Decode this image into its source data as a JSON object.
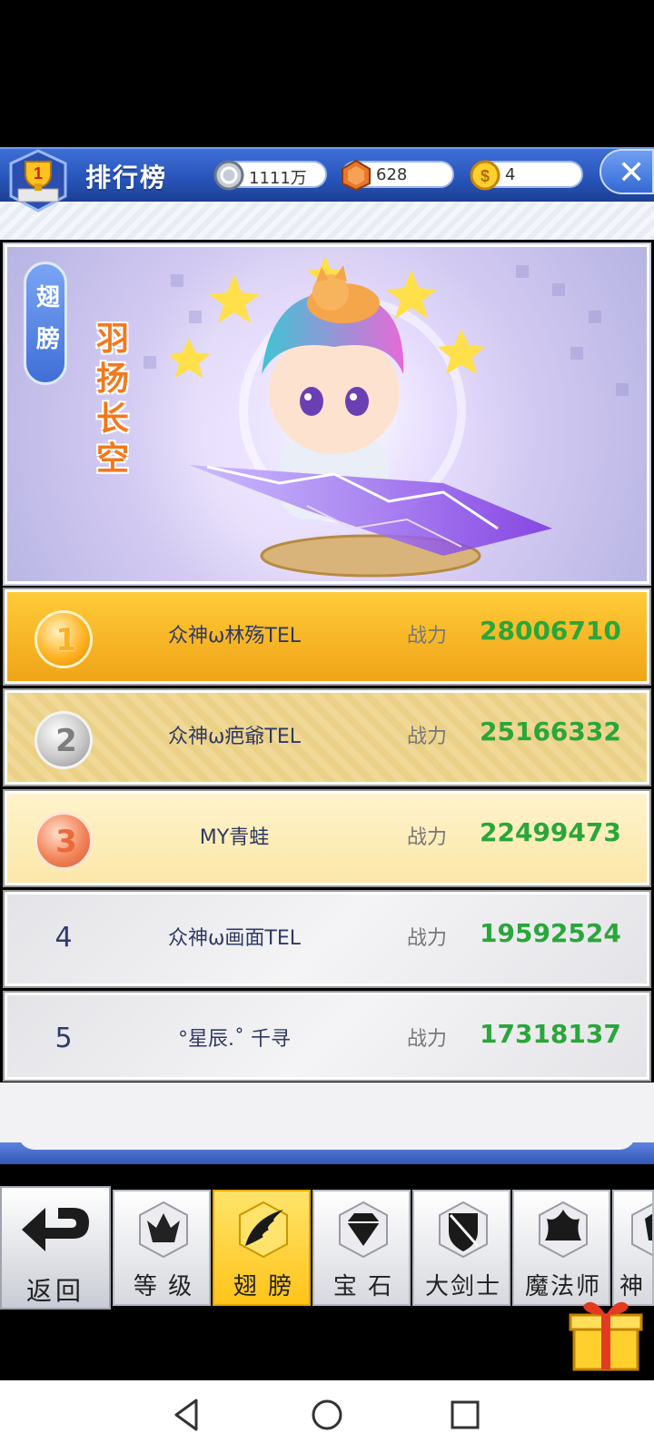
{
  "header": {
    "title": "排行榜",
    "resources": [
      {
        "icon": "silver-coin-icon",
        "value": "1111万"
      },
      {
        "icon": "crystal-icon",
        "value": "628"
      },
      {
        "icon": "gold-coin-icon",
        "value": "4"
      }
    ]
  },
  "showcase": {
    "category_tag": [
      "翅",
      "膀"
    ],
    "wing_name": [
      "羽",
      "扬",
      "长",
      "空"
    ]
  },
  "ranking": [
    {
      "rank": "1",
      "name": "众神ω林殇TEL",
      "label": "战力",
      "value": "28006710"
    },
    {
      "rank": "2",
      "name": "众神ω疤爺TEL",
      "label": "战力",
      "value": "25166332"
    },
    {
      "rank": "3",
      "name": "MY青蛙",
      "label": "战力",
      "value": "22499473"
    },
    {
      "rank": "4",
      "name": "众神ω画面TEL",
      "label": "战力",
      "value": "19592524"
    },
    {
      "rank": "5",
      "name": "°星辰.˚ 千寻",
      "label": "战力",
      "value": "17318137"
    }
  ],
  "tabs": {
    "back": "返回",
    "items": [
      "等 级",
      "翅 膀",
      "宝 石",
      "大剑士",
      "魔法师",
      "神"
    ],
    "active": "翅 膀"
  },
  "colors": {
    "header_blue": "#2753b8",
    "gold_row": "#ffcb38",
    "power_green": "#2aa63a",
    "active_tab": "#ffc41a"
  }
}
